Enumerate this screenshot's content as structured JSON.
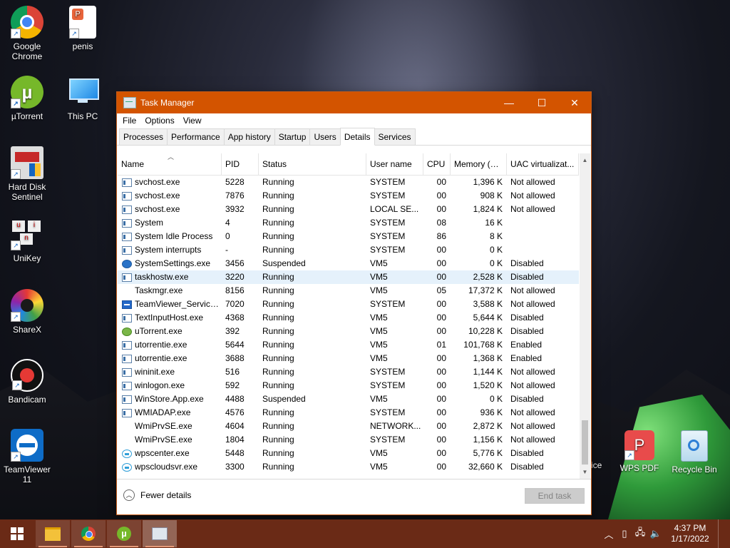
{
  "desktop": {
    "icons": [
      {
        "label": "Google Chrome",
        "icon": "chrome-icon"
      },
      {
        "label": "penis",
        "icon": "wps-presentation-icon"
      },
      {
        "label": "µTorrent",
        "icon": "utorrent-icon"
      },
      {
        "label": "This PC",
        "icon": "computer-icon"
      },
      {
        "label": "Hard Disk Sentinel",
        "icon": "hard-disk-icon"
      },
      {
        "label": "UniKey",
        "icon": "unikey-icon"
      },
      {
        "label": "ShareX",
        "icon": "sharex-icon"
      },
      {
        "label": "Bandicam",
        "icon": "bandicam-icon"
      },
      {
        "label": "TeamViewer 11",
        "icon": "teamviewer-icon"
      },
      {
        "label": "fice",
        "icon": "office-icon"
      },
      {
        "label": "WPS PDF",
        "icon": "wps-pdf-icon"
      },
      {
        "label": "Recycle Bin",
        "icon": "recycle-bin-icon"
      }
    ]
  },
  "window": {
    "title": "Task Manager",
    "controls": {
      "minimize": "—",
      "maximize": "☐",
      "close": "✕"
    },
    "menu": [
      "File",
      "Options",
      "View"
    ],
    "tabs": [
      "Processes",
      "Performance",
      "App history",
      "Startup",
      "Users",
      "Details",
      "Services"
    ],
    "active_tab": "Details",
    "columns": {
      "name": "Name",
      "pid": "PID",
      "status": "Status",
      "user": "User name",
      "cpu": "CPU",
      "memory": "Memory (a...",
      "uac": "UAC virtualizat..."
    },
    "rows": [
      {
        "name": "svchost.exe",
        "pid": "5228",
        "status": "Running",
        "user": "SYSTEM",
        "cpu": "00",
        "mem": "1,396 K",
        "uac": "Not allowed",
        "icon": "process-icon"
      },
      {
        "name": "svchost.exe",
        "pid": "7876",
        "status": "Running",
        "user": "SYSTEM",
        "cpu": "00",
        "mem": "908 K",
        "uac": "Not allowed",
        "icon": "process-icon"
      },
      {
        "name": "svchost.exe",
        "pid": "3932",
        "status": "Running",
        "user": "LOCAL SE...",
        "cpu": "00",
        "mem": "1,824 K",
        "uac": "Not allowed",
        "icon": "process-icon"
      },
      {
        "name": "System",
        "pid": "4",
        "status": "Running",
        "user": "SYSTEM",
        "cpu": "08",
        "mem": "16 K",
        "uac": "",
        "icon": "process-icon"
      },
      {
        "name": "System Idle Process",
        "pid": "0",
        "status": "Running",
        "user": "SYSTEM",
        "cpu": "86",
        "mem": "8 K",
        "uac": "",
        "icon": "process-icon"
      },
      {
        "name": "System interrupts",
        "pid": "-",
        "status": "Running",
        "user": "SYSTEM",
        "cpu": "00",
        "mem": "0 K",
        "uac": "",
        "icon": "process-icon"
      },
      {
        "name": "SystemSettings.exe",
        "pid": "3456",
        "status": "Suspended",
        "user": "VM5",
        "cpu": "00",
        "mem": "0 K",
        "uac": "Disabled",
        "icon": "settings-gear-icon"
      },
      {
        "name": "taskhostw.exe",
        "pid": "3220",
        "status": "Running",
        "user": "VM5",
        "cpu": "00",
        "mem": "2,528 K",
        "uac": "Disabled",
        "icon": "process-icon"
      },
      {
        "name": "Taskmgr.exe",
        "pid": "8156",
        "status": "Running",
        "user": "VM5",
        "cpu": "05",
        "mem": "17,372 K",
        "uac": "Not allowed",
        "icon": "task-manager-icon"
      },
      {
        "name": "TeamViewer_Service....",
        "pid": "7020",
        "status": "Running",
        "user": "SYSTEM",
        "cpu": "00",
        "mem": "3,588 K",
        "uac": "Not allowed",
        "icon": "teamviewer-icon"
      },
      {
        "name": "TextInputHost.exe",
        "pid": "4368",
        "status": "Running",
        "user": "VM5",
        "cpu": "00",
        "mem": "5,644 K",
        "uac": "Disabled",
        "icon": "process-icon"
      },
      {
        "name": "uTorrent.exe",
        "pid": "392",
        "status": "Running",
        "user": "VM5",
        "cpu": "00",
        "mem": "10,228 K",
        "uac": "Disabled",
        "icon": "utorrent-icon"
      },
      {
        "name": "utorrentie.exe",
        "pid": "5644",
        "status": "Running",
        "user": "VM5",
        "cpu": "01",
        "mem": "101,768 K",
        "uac": "Enabled",
        "icon": "process-icon"
      },
      {
        "name": "utorrentie.exe",
        "pid": "3688",
        "status": "Running",
        "user": "VM5",
        "cpu": "00",
        "mem": "1,368 K",
        "uac": "Enabled",
        "icon": "process-icon"
      },
      {
        "name": "wininit.exe",
        "pid": "516",
        "status": "Running",
        "user": "SYSTEM",
        "cpu": "00",
        "mem": "1,144 K",
        "uac": "Not allowed",
        "icon": "process-icon"
      },
      {
        "name": "winlogon.exe",
        "pid": "592",
        "status": "Running",
        "user": "SYSTEM",
        "cpu": "00",
        "mem": "1,520 K",
        "uac": "Not allowed",
        "icon": "process-icon"
      },
      {
        "name": "WinStore.App.exe",
        "pid": "4488",
        "status": "Suspended",
        "user": "VM5",
        "cpu": "00",
        "mem": "0 K",
        "uac": "Disabled",
        "icon": "process-icon"
      },
      {
        "name": "WMIADAP.exe",
        "pid": "4576",
        "status": "Running",
        "user": "SYSTEM",
        "cpu": "00",
        "mem": "936 K",
        "uac": "Not allowed",
        "icon": "process-icon"
      },
      {
        "name": "WmiPrvSE.exe",
        "pid": "4604",
        "status": "Running",
        "user": "NETWORK...",
        "cpu": "00",
        "mem": "2,872 K",
        "uac": "Not allowed",
        "icon": "wmi-icon"
      },
      {
        "name": "WmiPrvSE.exe",
        "pid": "1804",
        "status": "Running",
        "user": "SYSTEM",
        "cpu": "00",
        "mem": "1,156 K",
        "uac": "Not allowed",
        "icon": "wmi-icon"
      },
      {
        "name": "wpscenter.exe",
        "pid": "5448",
        "status": "Running",
        "user": "VM5",
        "cpu": "00",
        "mem": "5,776 K",
        "uac": "Disabled",
        "icon": "wps-cloud-icon"
      },
      {
        "name": "wpscloudsvr.exe",
        "pid": "3300",
        "status": "Running",
        "user": "VM5",
        "cpu": "00",
        "mem": "32,660 K",
        "uac": "Disabled",
        "icon": "wps-cloud-icon"
      }
    ],
    "selected_row": "taskhostw.exe",
    "footer": {
      "fewer_details": "Fewer details",
      "end_task": "End task"
    }
  },
  "taskbar": {
    "apps": [
      "file-explorer-icon",
      "chrome-icon",
      "utorrent-icon",
      "task-manager-icon"
    ],
    "time": "4:37 PM",
    "date": "1/17/2022"
  }
}
